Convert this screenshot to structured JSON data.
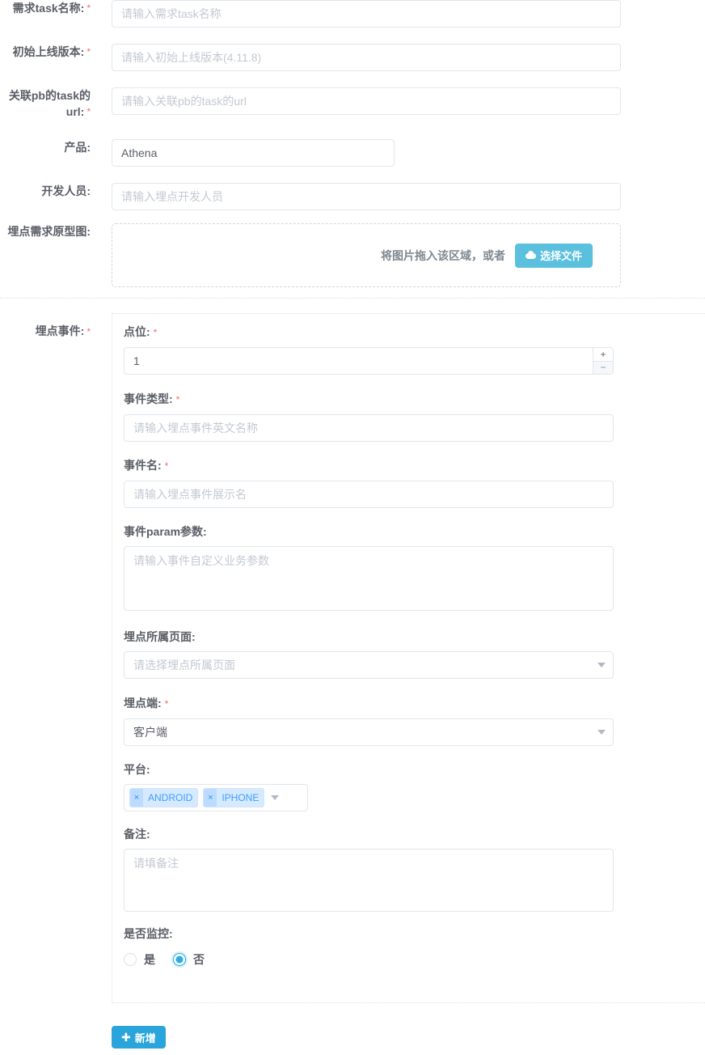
{
  "form": {
    "fields": [
      {
        "label": "需求task名称:",
        "required": true,
        "placeholder": "请输入需求task名称",
        "value": "",
        "type": "text"
      },
      {
        "label": "初始上线版本:",
        "required": true,
        "placeholder": "请输入初始上线版本(4.11.8)",
        "value": "",
        "type": "text"
      },
      {
        "label": "关联pb的task的url:",
        "required": true,
        "placeholder": "请输入关联pb的task的url",
        "value": "",
        "type": "text"
      },
      {
        "label": "产品:",
        "required": false,
        "placeholder": "",
        "value": "Athena",
        "type": "text"
      },
      {
        "label": "开发人员:",
        "required": false,
        "placeholder": "请输入埋点开发人员",
        "value": "",
        "type": "text"
      }
    ],
    "upload": {
      "label": "埋点需求原型图:",
      "required": false,
      "drag_text": "将图片拖入该区域，或者",
      "button_label": "选择文件",
      "button_icon": "cloud-upload-icon",
      "button_color": "#5bc0de"
    },
    "event_section": {
      "label": "埋点事件:",
      "required": true,
      "point": {
        "label": "点位:",
        "required": true,
        "value": "1",
        "spinner_up": "+",
        "spinner_down": "−"
      },
      "event_type": {
        "label": "事件类型:",
        "required": true,
        "placeholder": "请输入埋点事件英文名称",
        "value": ""
      },
      "event_name": {
        "label": "事件名:",
        "required": true,
        "placeholder": "请输入埋点事件展示名",
        "value": ""
      },
      "event_param": {
        "label": "事件param参数:",
        "required": false,
        "placeholder": "请输入事件自定义业务参数",
        "value": ""
      },
      "page_belong": {
        "label": "埋点所属页面:",
        "required": false,
        "placeholder": "请选择埋点所属页面",
        "value": "",
        "icon": "chevron-down-icon"
      },
      "terminal": {
        "label": "埋点端:",
        "required": true,
        "placeholder": "",
        "value": "客户端",
        "icon": "chevron-down-icon"
      },
      "platform": {
        "label": "平台:",
        "required": false,
        "tags": [
          "ANDROID",
          "IPHONE"
        ],
        "tag_remove_icon": "×",
        "icon": "chevron-down-icon",
        "tag_bg": "#d6eaff",
        "tag_color": "#409eff"
      },
      "remark": {
        "label": "备注:",
        "required": false,
        "placeholder": "请填备注",
        "value": ""
      },
      "monitor": {
        "label": "是否监控:",
        "required": false,
        "options": [
          {
            "text": "是",
            "selected": false
          },
          {
            "text": "否",
            "selected": true
          }
        ],
        "selected_color": "#2cace3"
      }
    },
    "add_button": {
      "label": "新增",
      "icon": "plus-icon",
      "color": "#29a5dc"
    }
  }
}
